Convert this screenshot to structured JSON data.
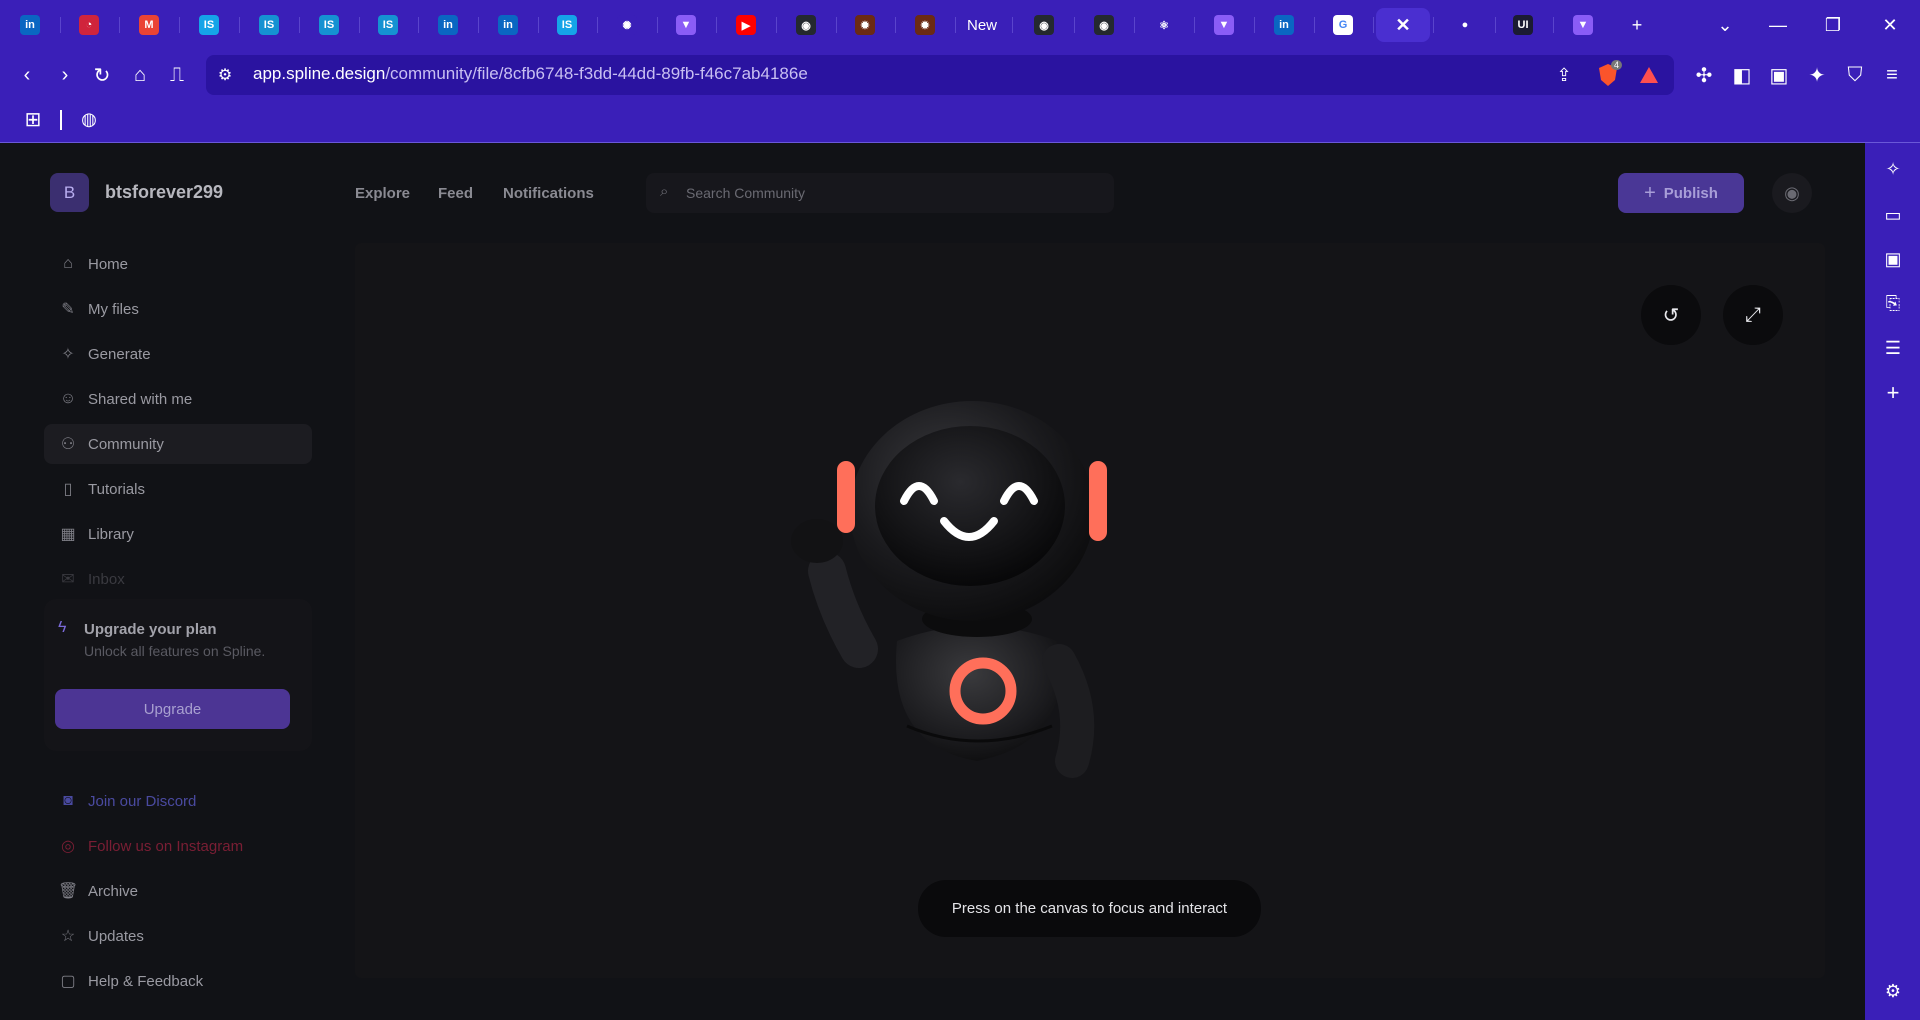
{
  "browser": {
    "tabs": [
      {
        "icon": "linkedin-icon",
        "glyph": "in",
        "color": "#0a66c2"
      },
      {
        "icon": "speedometer-icon",
        "glyph": "◔",
        "color": "#d0243c"
      },
      {
        "icon": "gmail-icon",
        "glyph": "M",
        "color": "#ea4335"
      },
      {
        "icon": "is-icon",
        "glyph": "IS",
        "color": "#15a4e8"
      },
      {
        "icon": "is-circle-icon",
        "glyph": "IS",
        "color": "#1592d2"
      },
      {
        "icon": "is-circle-icon",
        "glyph": "IS",
        "color": "#1592d2"
      },
      {
        "icon": "is-circle-icon",
        "glyph": "IS",
        "color": "#1592d2"
      },
      {
        "icon": "linkedin-icon",
        "glyph": "in",
        "color": "#0a66c2"
      },
      {
        "icon": "linkedin-icon",
        "glyph": "in",
        "color": "#0a66c2"
      },
      {
        "icon": "is-icon",
        "glyph": "IS",
        "color": "#15a4e8"
      },
      {
        "icon": "openai-icon",
        "glyph": "✺",
        "color": "#3a1fb8"
      },
      {
        "icon": "vite-icon",
        "glyph": "▼",
        "color": "#8a5cf6"
      },
      {
        "icon": "youtube-icon",
        "glyph": "▶",
        "color": "#ff0000"
      },
      {
        "icon": "github-icon",
        "glyph": "◉",
        "color": "#24292f"
      },
      {
        "icon": "fire-icon",
        "glyph": "✹",
        "color": "#6b2a12"
      },
      {
        "icon": "fire-icon",
        "glyph": "✹",
        "color": "#6b2a12"
      },
      {
        "icon": "new-tab-text",
        "glyph": "New",
        "color": "transparent"
      },
      {
        "icon": "github-icon",
        "glyph": "◉",
        "color": "#24292f"
      },
      {
        "icon": "github-icon",
        "glyph": "◉",
        "color": "#24292f"
      },
      {
        "icon": "react-icon",
        "glyph": "⚛",
        "color": "transparent"
      },
      {
        "icon": "vite-icon",
        "glyph": "▼",
        "color": "#8a5cf6"
      },
      {
        "icon": "linkedin-icon",
        "glyph": "in",
        "color": "#0a66c2"
      },
      {
        "icon": "google-icon",
        "glyph": "G",
        "color": "#ffffff"
      },
      {
        "icon": "close-icon",
        "glyph": "✕",
        "color": "transparent",
        "active": true
      },
      {
        "icon": "gradient-orb-icon",
        "glyph": "●",
        "color": "transparent"
      },
      {
        "icon": "ui-icon",
        "glyph": "UI",
        "color": "#1b1b33"
      },
      {
        "icon": "vite-icon",
        "glyph": "▼",
        "color": "#8a5cf6"
      }
    ],
    "url_host": "app.spline.design",
    "url_path": "/community/file/8cfb6748-f3dd-44dd-89fb-f46c7ab4186e",
    "brave_shield_count": "4"
  },
  "app": {
    "workspace_initial": "B",
    "workspace_name": "btsforever299",
    "sidebar": [
      {
        "name": "sidebar-item-home",
        "icon": "home-icon",
        "glyph": "⌂",
        "label": "Home"
      },
      {
        "name": "sidebar-item-my-files",
        "icon": "pencil-icon",
        "glyph": "✎",
        "label": "My files"
      },
      {
        "name": "sidebar-item-generate",
        "icon": "sparkle-icon",
        "glyph": "✧",
        "label": "Generate"
      },
      {
        "name": "sidebar-item-shared",
        "icon": "user-circle-icon",
        "glyph": "☺",
        "label": "Shared with me"
      },
      {
        "name": "sidebar-item-community",
        "icon": "users-icon",
        "glyph": "⚇",
        "label": "Community",
        "active": true
      },
      {
        "name": "sidebar-item-tutorials",
        "icon": "book-icon",
        "glyph": "▯",
        "label": "Tutorials"
      },
      {
        "name": "sidebar-item-library",
        "icon": "library-icon",
        "glyph": "▦",
        "label": "Library"
      },
      {
        "name": "sidebar-item-inbox",
        "icon": "inbox-icon",
        "glyph": "✉",
        "label": "Inbox",
        "faded": true
      }
    ],
    "upgrade": {
      "title": "Upgrade your plan",
      "subtitle": "Unlock all features on Spline.",
      "button": "Upgrade"
    },
    "sidebar_bottom": [
      {
        "name": "sidebar-item-discord",
        "icon": "discord-icon",
        "glyph": "◙",
        "label": "Join our Discord",
        "color": "#4a4aa0"
      },
      {
        "name": "sidebar-item-instagram",
        "icon": "instagram-icon",
        "glyph": "◎",
        "label": "Follow us on Instagram",
        "color": "#7a1e34"
      },
      {
        "name": "sidebar-item-archive",
        "icon": "trash-icon",
        "glyph": "🗑",
        "label": "Archive"
      },
      {
        "name": "sidebar-item-updates",
        "icon": "star-icon",
        "glyph": "☆",
        "label": "Updates"
      },
      {
        "name": "sidebar-item-help",
        "icon": "chat-icon",
        "glyph": "▢",
        "label": "Help & Feedback"
      }
    ],
    "topnav": [
      "Explore",
      "Feed",
      "Notifications"
    ],
    "search_placeholder": "Search Community",
    "publish_label": "Publish",
    "canvas_hint": "Press on the canvas to focus and interact"
  },
  "colors": {
    "browser_accent": "#3a1fb8",
    "robot_glow": "#ff6f5a"
  }
}
